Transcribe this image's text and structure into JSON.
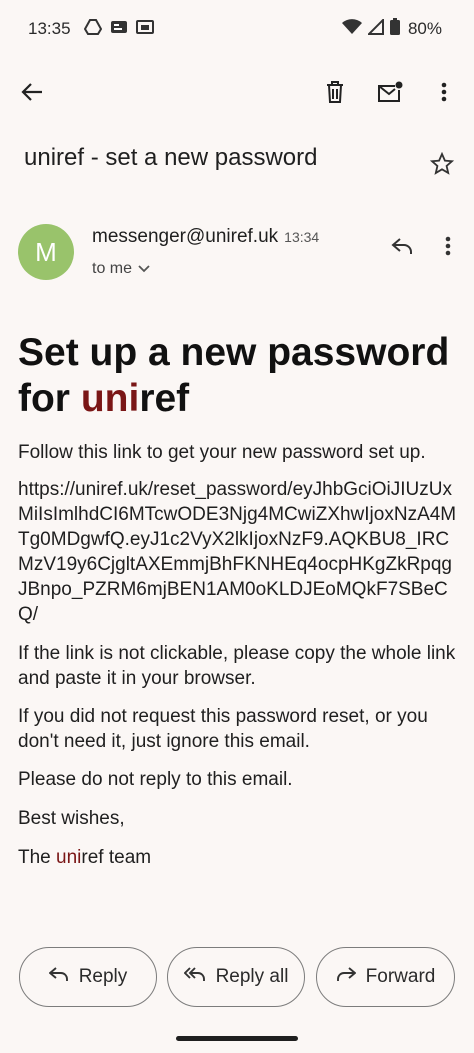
{
  "status_bar": {
    "time": "13:35",
    "battery": "80%",
    "icons": [
      "drive-icon",
      "google-news-icon",
      "tablet-icon",
      "wifi-icon",
      "signal-icon",
      "battery-icon"
    ]
  },
  "app_bar": {
    "actions": [
      "back-icon",
      "delete-icon",
      "mark-unread-icon",
      "more-vert-icon"
    ]
  },
  "subject": "uniref - set a new password",
  "header": {
    "avatar_letter": "M",
    "sender": "messenger@uniref.uk",
    "time": "13:34",
    "to": "to me"
  },
  "email": {
    "heading_prefix": "Set up a new password for ",
    "brand_uni": "uni",
    "brand_ref": "ref",
    "intro": "Follow this link to get your new password set up.",
    "link": "https://uniref.uk/reset_password/eyJhbGciOiJIUzUxMiIsImlhdCI6MTcwODE3Njg4MCwiZXhwIjoxNzA4MTg0MDgwfQ.eyJ1c2VyX2lkIjoxNzF9.AQKBU8_IRCMzV19y6CjgltAXEmmjBhFKNHEq4ocpHKgZkRpqgJBnpo_PZRM6mjBEN1AM0oKLDJEoMQkF7SBeCQ/",
    "not_clickable": "If the link is not clickable, please copy the whole link and paste it in your browser.",
    "ignore": "If you did not request this password reset, or you don't need it, just ignore this email.",
    "no_reply": "Please do not reply to this email.",
    "wishes": "Best wishes,",
    "sign_prefix": "The ",
    "sign_uni": "uni",
    "sign_rest": "ref team"
  },
  "actions": {
    "reply": "Reply",
    "reply_all": "Reply all",
    "forward": "Forward"
  },
  "colors": {
    "background": "#fbf7f5",
    "avatar": "#99c36b",
    "link": "#3f72c9",
    "brand": "#7a1616"
  }
}
